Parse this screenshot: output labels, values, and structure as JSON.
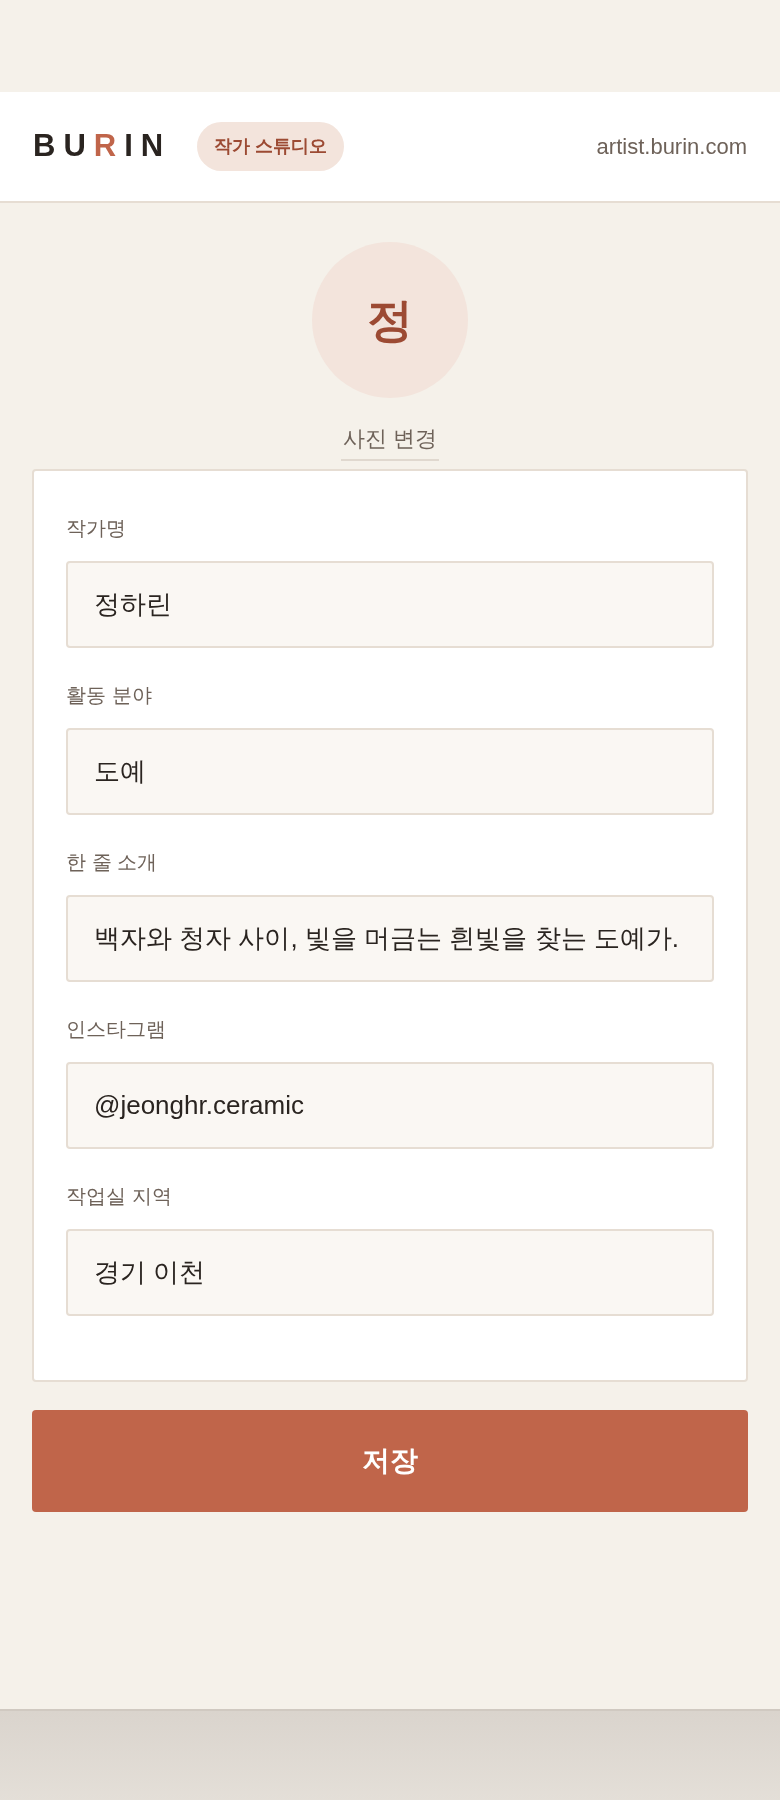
{
  "header": {
    "logo": [
      {
        "letter": "B",
        "accent": false
      },
      {
        "letter": "U",
        "accent": false
      },
      {
        "letter": "R",
        "accent": true
      },
      {
        "letter": "I",
        "accent": false
      },
      {
        "letter": "N",
        "accent": false
      }
    ],
    "badge": "작가 스튜디오",
    "domain": "artist.burin.com"
  },
  "avatar": {
    "initial": "정",
    "change_link": "사진 변경"
  },
  "fields": [
    {
      "label": "작가명",
      "value": "정하린"
    },
    {
      "label": "활동 분야",
      "value": "도예"
    },
    {
      "label": "한 줄 소개",
      "value": "백자와 청자 사이, 빛을 머금는 흰빛을 찾는 도예가."
    },
    {
      "label": "인스타그램",
      "value": "@jeonghr.ceramic"
    },
    {
      "label": "작업실 지역",
      "value": "경기 이천"
    }
  ],
  "save_button": "저장"
}
